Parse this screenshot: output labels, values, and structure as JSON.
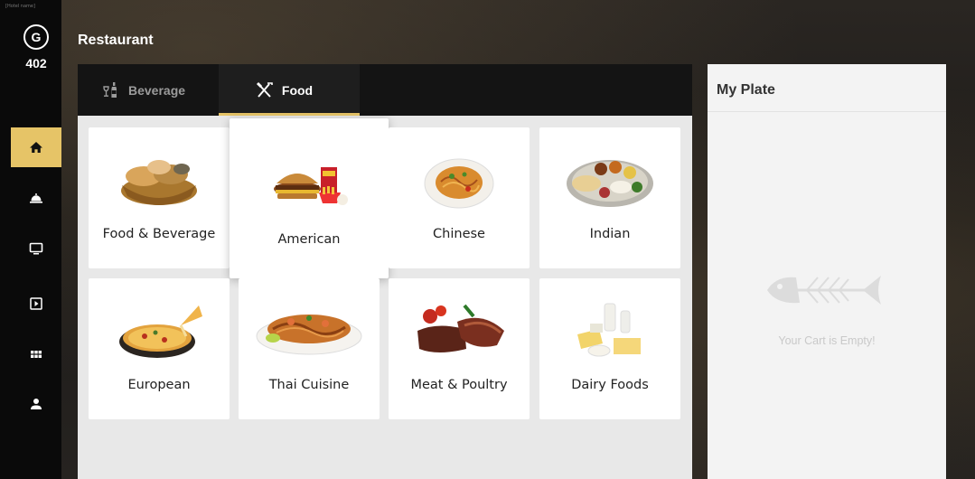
{
  "sidebar": {
    "tiny_label": "[Hotel name]",
    "avatar_initial": "G",
    "room_number": "402",
    "items": [
      {
        "name": "home",
        "active": true
      },
      {
        "name": "room-service",
        "active": false
      },
      {
        "name": "tv",
        "active": false
      },
      {
        "name": "media",
        "active": false
      },
      {
        "name": "apps",
        "active": false
      },
      {
        "name": "profile",
        "active": false
      }
    ]
  },
  "header": {
    "title": "Restaurant"
  },
  "tabs": [
    {
      "label": "Beverage",
      "icon": "wine-bottle-icon",
      "active": false
    },
    {
      "label": "Food",
      "icon": "fork-knife-icon",
      "active": true
    }
  ],
  "categories": [
    {
      "label": "Food & Beverage",
      "image": "bread-basket"
    },
    {
      "label": "American",
      "image": "burger-meal"
    },
    {
      "label": "Chinese",
      "image": "noodle-plate"
    },
    {
      "label": "Indian",
      "image": "thali-plate"
    },
    {
      "label": "European",
      "image": "pizza"
    },
    {
      "label": "Thai Cuisine",
      "image": "pad-thai"
    },
    {
      "label": "Meat & Poultry",
      "image": "steak"
    },
    {
      "label": "Dairy Foods",
      "image": "dairy"
    }
  ],
  "plate": {
    "title": "My Plate",
    "empty_message": "Your Cart is Empty!"
  },
  "colors": {
    "accent": "#e6c467",
    "sidebar": "#0a0a0a",
    "tab_bar": "#141414"
  }
}
